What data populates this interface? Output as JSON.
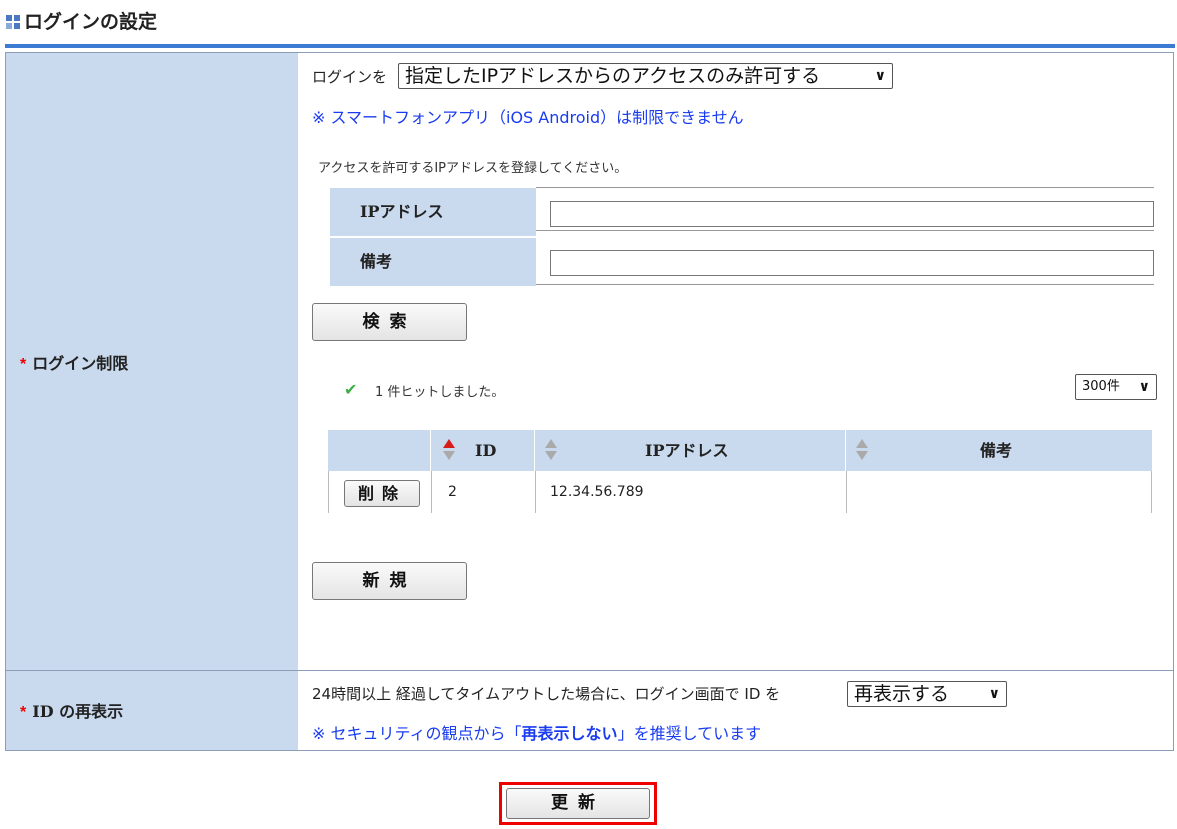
{
  "header": {
    "title": "ログインの設定"
  },
  "login_restriction": {
    "label": "ログイン制限",
    "prefix": "ログインを",
    "mode_value": "指定したIPアドレスからのアクセスのみ許可する",
    "note": "※ スマートフォンアプリ（iOS Android）は制限できません",
    "instruction": "アクセスを許可するIPアドレスを登録してください。",
    "search": {
      "ip_label": "IPアドレス",
      "ip_value": "",
      "remarks_label": "備考",
      "remarks_value": "",
      "button": "検索"
    },
    "result_message": "1 件ヒットしました。",
    "per_page": "300件",
    "table": {
      "columns": [
        "ID",
        "IPアドレス",
        "備考"
      ],
      "rows": [
        {
          "delete_label": "削除",
          "id": "2",
          "ip": "12.34.56.789",
          "remarks": ""
        }
      ]
    },
    "new_button": "新規"
  },
  "id_redisplay": {
    "label": "ID の再表示",
    "text": "24時間以上 経過してタイムアウトした場合に、ログイン画面で ID を",
    "select_value": "再表示する",
    "note_prefix": "※ セキュリティの観点から「",
    "note_emphasis": "再表示しない",
    "note_suffix": "」を推奨しています"
  },
  "footer": {
    "update_button": "更新"
  },
  "colors": {
    "label_bg": "#c9d9ee",
    "title_rule": "#3c7bd3",
    "note_blue": "#1a3cf0",
    "required_mark": "#ee0000",
    "highlight_border": "#ee0000",
    "check": "#3cb043"
  }
}
